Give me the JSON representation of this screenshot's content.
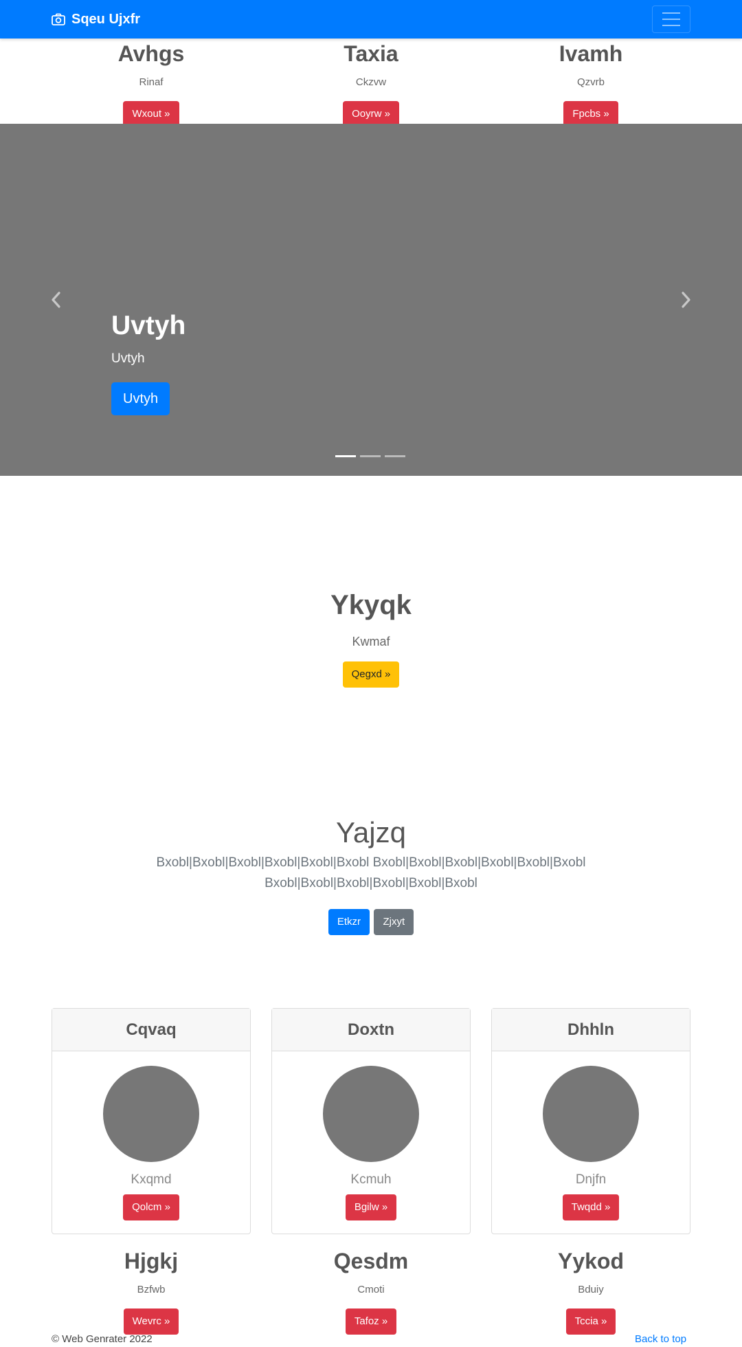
{
  "navbar": {
    "brand": "Sqeu Ujxfr",
    "brand_icon": "camera-icon",
    "toggler_icon": "hamburger-menu-icon",
    "color": "#007bff"
  },
  "top_columns": [
    {
      "title": "Avhgs",
      "subtitle": "Rinaf",
      "button": "Wxout »"
    },
    {
      "title": "Taxia",
      "subtitle": "Ckzvw",
      "button": "Ooyrw »"
    },
    {
      "title": "Ivamh",
      "subtitle": "Qzvrb",
      "button": "Fpcbs »"
    }
  ],
  "carousel": {
    "title": "Uvtyh",
    "subtitle": "Uvtyh",
    "button": "Uvtyh",
    "prev_icon": "chevron-left-icon",
    "next_icon": "chevron-right-icon",
    "slide_count": 3,
    "active_slide": 1
  },
  "hero": {
    "title": "Ykyqk",
    "subtitle": "Kwmaf",
    "button": "Qegxd »"
  },
  "jumbotron": {
    "title": "Yajzq",
    "line1": "Bxobl|Bxobl|Bxobl|Bxobl|Bxobl|Bxobl Bxobl|Bxobl|Bxobl|Bxobl|Bxobl|Bxobl",
    "line2": "Bxobl|Bxobl|Bxobl|Bxobl|Bxobl|Bxobl",
    "primary_button": "Etkzr",
    "secondary_button": "Zjxyt"
  },
  "cards": [
    {
      "header": "Cqvaq",
      "name": "Kxqmd",
      "button": "Qolcm »"
    },
    {
      "header": "Doxtn",
      "name": "Kcmuh",
      "button": "Bgilw »"
    },
    {
      "header": "Dhhln",
      "name": "Dnjfn",
      "button": "Twqdd »"
    }
  ],
  "bottom_columns": [
    {
      "title": "Hjgkj",
      "subtitle": "Bzfwb",
      "button": "Wevrc »"
    },
    {
      "title": "Qesdm",
      "subtitle": "Cmoti",
      "button": "Tafoz »"
    },
    {
      "title": "Yykod",
      "subtitle": "Bduiy",
      "button": "Tccia »"
    }
  ],
  "footer": {
    "copyright": "© Web Genrater 2022",
    "back_to_top": "Back to top"
  }
}
